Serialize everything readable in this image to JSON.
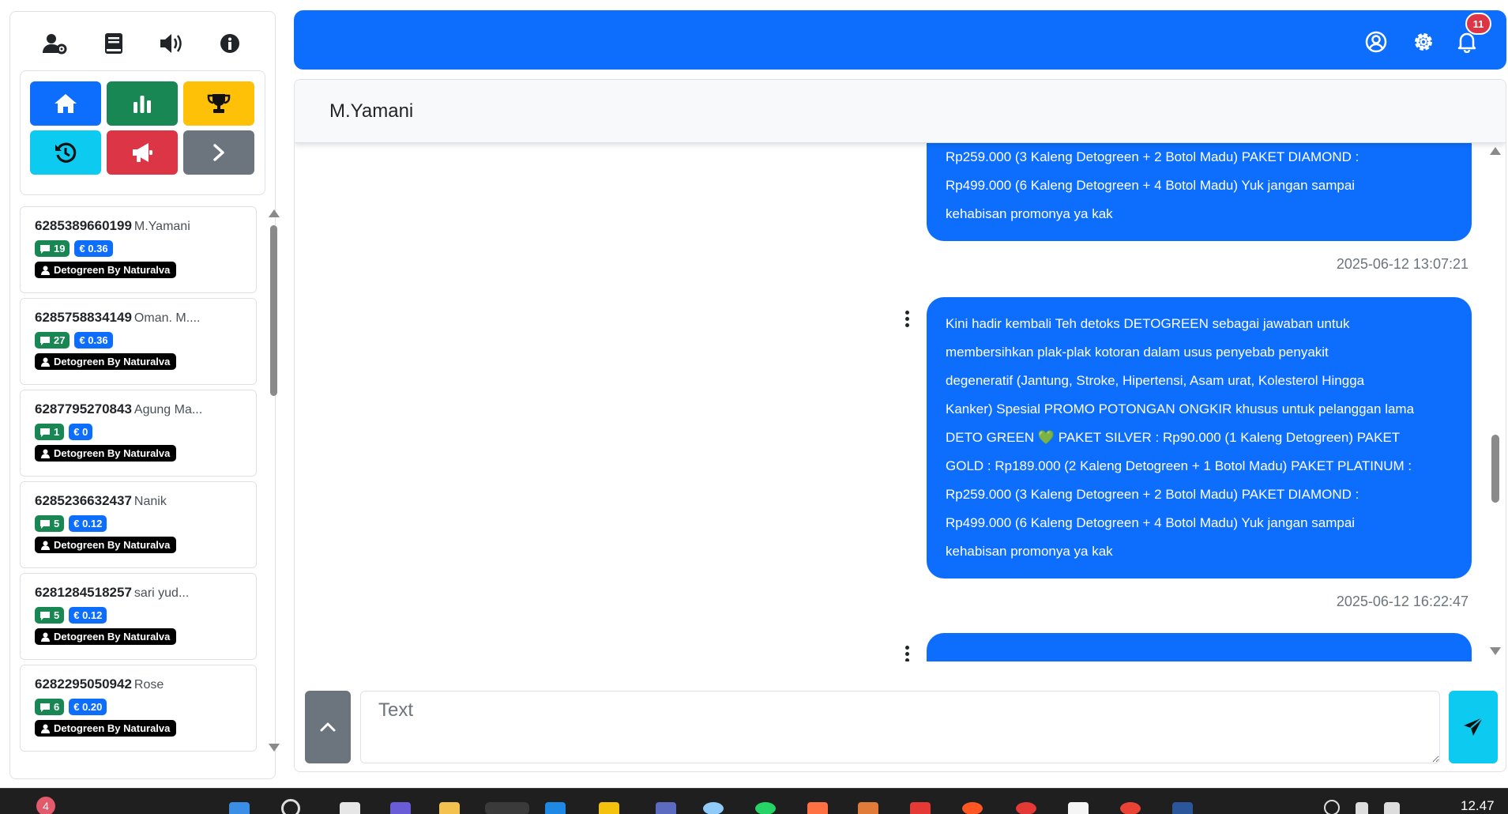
{
  "sidebar": {
    "top_icons": [
      "user-gear-icon",
      "book-icon",
      "volume-icon",
      "info-icon"
    ],
    "nav_buttons": [
      {
        "name": "home-button",
        "icon": "home-icon",
        "color": "#0d6efd"
      },
      {
        "name": "stats-button",
        "icon": "chart-bar-icon",
        "color": "#198754"
      },
      {
        "name": "trophy-button",
        "icon": "trophy-icon",
        "color": "#ffc107"
      },
      {
        "name": "history-button",
        "icon": "history-icon",
        "color": "#0dcaf0"
      },
      {
        "name": "broadcast-button",
        "icon": "megaphone-icon",
        "color": "#dc3545"
      },
      {
        "name": "next-button",
        "icon": "chevron-right-icon",
        "color": "#6c757d"
      }
    ],
    "contacts": [
      {
        "phone": "6285389660199",
        "name": "M.Yamani",
        "messages": "19",
        "cost": "€ 0.36",
        "label": "Detogreen By Naturalva"
      },
      {
        "phone": "6285758834149",
        "name": "Oman. M....",
        "messages": "27",
        "cost": "€ 0.36",
        "label": "Detogreen By Naturalva"
      },
      {
        "phone": "6287795270843",
        "name": "Agung Ma...",
        "messages": "1",
        "cost": "€ 0",
        "label": "Detogreen By Naturalva"
      },
      {
        "phone": "6285236632437",
        "name": "Nanik",
        "messages": "5",
        "cost": "€ 0.12",
        "label": "Detogreen By Naturalva"
      },
      {
        "phone": "6281284518257",
        "name": "sari yud...",
        "messages": "5",
        "cost": "€ 0.12",
        "label": "Detogreen By Naturalva"
      },
      {
        "phone": "6282295050942",
        "name": "Rose",
        "messages": "6",
        "cost": "€ 0.20",
        "label": "Detogreen By Naturalva"
      }
    ]
  },
  "header": {
    "icons": [
      "user-circle-icon",
      "gear-icon",
      "bell-icon"
    ],
    "notification_count": "11",
    "accent": "#0d6efd"
  },
  "chat": {
    "contact_name": "M.Yamani",
    "messages": [
      {
        "lines": [
          "Rp259.000 (3 Kaleng Detogreen + 2 Botol Madu) PAKET DIAMOND :",
          "Rp499.000 (6 Kaleng Detogreen + 4 Botol Madu) Yuk jangan sampai",
          "kehabisan promonya ya kak"
        ],
        "timestamp": "2025-06-12 13:07:21"
      },
      {
        "lines": [
          "Kini hadir kembali Teh detoks DETOGREEN sebagai jawaban untuk",
          "membersihkan plak-plak kotoran dalam usus penyebab penyakit",
          "degeneratif (Jantung, Stroke, Hipertensi, Asam urat, Kolesterol Hingga",
          "Kanker) Spesial PROMO POTONGAN ONGKIR khusus untuk pelanggan lama",
          "DETO GREEN 💚 PAKET SILVER : Rp90.000 (1 Kaleng Detogreen) PAKET",
          "GOLD : Rp189.000 (2 Kaleng Detogreen + 1 Botol Madu) PAKET PLATINUM :",
          "Rp259.000 (3 Kaleng Detogreen + 2 Botol Madu) PAKET DIAMOND :",
          "Rp499.000 (6 Kaleng Detogreen + 4 Botol Madu) Yuk jangan sampai",
          "kehabisan promonya ya kak"
        ],
        "timestamp": "2025-06-12 16:22:47"
      }
    ],
    "composer_placeholder": "Text"
  },
  "taskbar": {
    "notification_count": "4",
    "clock": "12.47"
  }
}
